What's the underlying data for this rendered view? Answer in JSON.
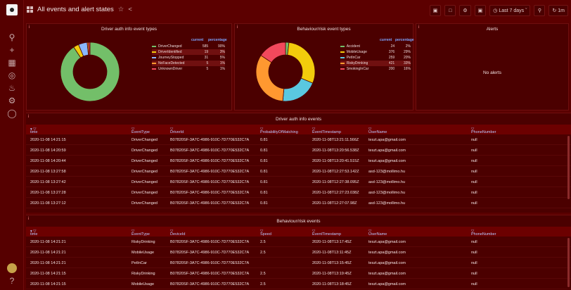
{
  "dashboard": {
    "title": "All events and alert states"
  },
  "toolbar": {
    "time_range": "Last 7 days",
    "refresh": "1m"
  },
  "icons": [
    "logo-icon",
    "search-icon",
    "plus-icon",
    "dashboards-icon",
    "explore-icon",
    "alerting-icon",
    "settings-icon",
    "shield-icon",
    "help-icon"
  ],
  "panel1": {
    "title": "Driver auth info event types",
    "legend_headers": [
      "current",
      "percentage"
    ],
    "items": [
      {
        "name": "DriverChanged",
        "count": "585",
        "pct": "90%",
        "color": "#73bf69"
      },
      {
        "name": "DriverIdentified",
        "count": "19",
        "pct": "3%",
        "color": "#f2cc0c"
      },
      {
        "name": "JourneyStopped",
        "count": "31",
        "pct": "5%",
        "color": "#8ab8ff"
      },
      {
        "name": "NoFaceDetected",
        "count": "5",
        "pct": "1%",
        "color": "#ff9830"
      },
      {
        "name": "UnknownDriver",
        "count": "5",
        "pct": "1%",
        "color": "#f2495c"
      }
    ],
    "pie_values": [
      585,
      19,
      31,
      5,
      5
    ]
  },
  "panel2": {
    "title": "Behaviour/risk event types",
    "legend_headers": [
      "current",
      "percentage"
    ],
    "items": [
      {
        "name": "Accident",
        "count": "24",
        "pct": "2%",
        "color": "#73bf69"
      },
      {
        "name": "MobileUsage",
        "count": "376",
        "pct": "29%",
        "color": "#f2cc0c"
      },
      {
        "name": "PetInCar",
        "count": "259",
        "pct": "20%",
        "color": "#5ac8e0"
      },
      {
        "name": "RiskyDrinking",
        "count": "421",
        "pct": "33%",
        "color": "#ff9830"
      },
      {
        "name": "SmokingInCar",
        "count": "200",
        "pct": "16%",
        "color": "#f2495c"
      }
    ],
    "pie_values": [
      24,
      376,
      259,
      421,
      200
    ]
  },
  "alerts": {
    "title": "Alerts",
    "empty_text": "No alerts"
  },
  "table1": {
    "title": "Driver auth info events",
    "columns": [
      "time",
      "EventType",
      "DriverId",
      "ProbabilityOfMatching",
      "EventTimestamp",
      "UserName",
      "PhoneNumber"
    ],
    "rows": [
      [
        "2020-11-08 14:21:15",
        "DriverChanged",
        "B07820SF-3A7C-4986-910C-7D770E532C7A",
        "0.81",
        "2020-11-08T13:21:11.566Z",
        "teszt.apa@gmail.com",
        "null"
      ],
      [
        "2020-11-08 14:20:59",
        "DriverChanged",
        "B07820SF-3A7C-4986-910C-7D770E532C7A",
        "0.81",
        "2020-11-08T13:20:56.538Z",
        "teszt.apa@gmail.com",
        "null"
      ],
      [
        "2020-11-08 14:20:44",
        "DriverChanged",
        "B07820SF-3A7C-4986-910C-7D770E532C7A",
        "0.81",
        "2020-11-08T13:20:41.515Z",
        "teszt.apa@gmail.com",
        "null"
      ],
      [
        "2020-11-08 13:27:58",
        "DriverChanged",
        "B07820SF-3A7C-4986-910C-7D770E532C7A",
        "0.81",
        "2020-11-08T12:27:53.142Z",
        "asd-123@mollimo.hu",
        "null"
      ],
      [
        "2020-11-08 13:27:42",
        "DriverChanged",
        "B07820SF-3A7C-4986-910C-7D770E532C7A",
        "0.81",
        "2020-11-08T12:27:38.095Z",
        "asd-123@mollimo.hu",
        "null"
      ],
      [
        "2020-11-08 13:27:28",
        "DriverChanged",
        "B07820SF-3A7C-4986-910C-7D770E532C7A",
        "0.81",
        "2020-11-08T12:27:23.038Z",
        "asd-123@mollimo.hu",
        "null"
      ],
      [
        "2020-11-08 13:27:12",
        "DriverChanged",
        "B07820SF-3A7C-4986-910C-7D770E532C7A",
        "0.81",
        "2020-11-08T12:27:07.98Z",
        "asd-123@mollimo.hu",
        "null"
      ]
    ]
  },
  "table2": {
    "title": "Behaviour/risk events",
    "columns": [
      "time",
      "EventType",
      "DeviceId",
      "Speed",
      "EventTimestamp",
      "UserName",
      "PhoneNumber"
    ],
    "rows": [
      [
        "2020-11-08 14:21:21",
        "RiskyDrinking",
        "B07820SF-3A7C-4986-910C-7D770E532C7A",
        "2.5",
        "2020-11-08T13:17:45Z",
        "teszt.apa@gmail.com",
        "null"
      ],
      [
        "2020-11-08 14:21:21",
        "MobileUsage",
        "B07820SF-3A7C-4986-910C-7D770E532C7A",
        "2.5",
        "2020-11-08T13:11:45Z",
        "teszt.apa@gmail.com",
        "null"
      ],
      [
        "2020-11-08 14:21:21",
        "PetInCar",
        "B07820SF-3A7C-4986-910C-7D770E532C7A",
        "",
        "2020-11-08T13:15:45Z",
        "teszt.apa@gmail.com",
        "null"
      ],
      [
        "2020-11-08 14:21:15",
        "RiskyDrinking",
        "B07820SF-3A7C-4986-910C-7D770E532C7A",
        "2.5",
        "2020-11-08T13:19:45Z",
        "teszt.apa@gmail.com",
        "null"
      ],
      [
        "2020-11-08 14:21:15",
        "MobileUsage",
        "B07820SF-3A7C-4986-910C-7D770E532C7A",
        "2.5",
        "2020-11-08T13:18:45Z",
        "teszt.apa@gmail.com",
        "null"
      ]
    ]
  }
}
